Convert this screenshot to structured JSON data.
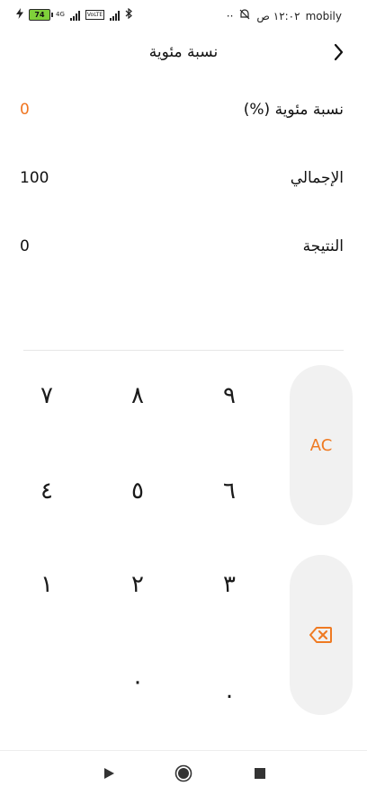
{
  "status_bar": {
    "carrier": "mobily",
    "time": "١٢:٠٢ ص",
    "dots": "··",
    "battery_level": "74",
    "network_label": "4G",
    "volte_label": "VoLTE"
  },
  "header": {
    "title": "نسبة مئوية"
  },
  "fields": [
    {
      "label": "نسبة مئوية (%)",
      "value": "0"
    },
    {
      "label": "الإجمالي",
      "value": "100"
    },
    {
      "label": "النتيجة",
      "value": "0"
    }
  ],
  "keypad": {
    "rows": [
      [
        "٧",
        "٨",
        "٩"
      ],
      [
        "٤",
        "٥",
        "٦"
      ],
      [
        "١",
        "٢",
        "٣"
      ],
      [
        "",
        "٠",
        "."
      ]
    ],
    "clear_label": "AC",
    "backspace_icon": "backspace-icon"
  },
  "colors": {
    "accent": "#f07520",
    "button_bg": "#f1f1f1"
  },
  "nav_bar": {
    "icons": [
      "play-icon",
      "record-icon",
      "stop-icon"
    ]
  }
}
